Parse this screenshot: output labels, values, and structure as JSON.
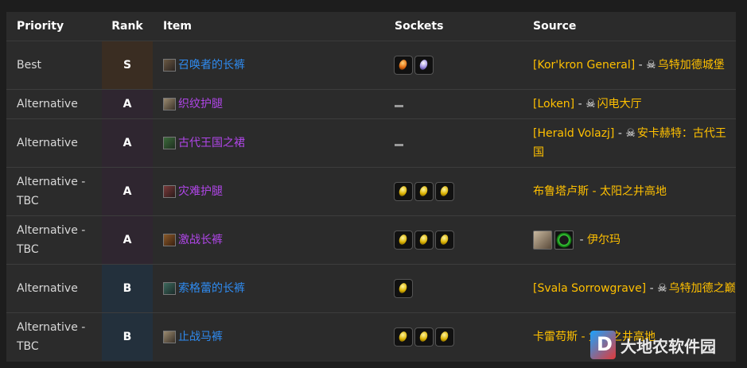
{
  "headers": [
    "Priority",
    "Rank",
    "Item",
    "Sockets",
    "Source"
  ],
  "rows": [
    {
      "priority": "Best",
      "rank": "S",
      "item": "召唤者的长裤",
      "source_boss": "[Kor'kron General]",
      "source_sep": " - ",
      "source_place": "乌特加德城堡"
    },
    {
      "priority": "Alternative",
      "rank": "A",
      "item": "织纹护腿",
      "source_boss": "[Loken]",
      "source_sep": " - ",
      "source_place": "闪电大厅"
    },
    {
      "priority": "Alternative",
      "rank": "A",
      "item": "古代王国之裙",
      "source_boss": "[Herald Volazj]",
      "source_sep": " - ",
      "source_place": "安卡赫特：古代王国"
    },
    {
      "priority": "Alternative - TBC",
      "rank": "A",
      "item": "灾难护腿",
      "source_text": "布鲁塔卢斯 - 太阳之井高地"
    },
    {
      "priority": "Alternative - TBC",
      "rank": "A",
      "item": "激战长裤",
      "source_sep": " - ",
      "source_place": "伊尔玛"
    },
    {
      "priority": "Alternative",
      "rank": "B",
      "item": "索格蕾的长裤",
      "source_boss": "[Svala Sorrowgrave]",
      "source_sep": " - ",
      "source_place": "乌特加德之巅"
    },
    {
      "priority": "Alternative - TBC",
      "rank": "B",
      "item": "止战马裤",
      "source_text": "卡雷苟斯 - 太阳之井高地"
    }
  ],
  "watermark": {
    "text": "大地农软件园",
    "logo_letter": "D"
  },
  "colors": {
    "rank_s": "#3a2d22",
    "rank_a": "#2f2630",
    "rank_b": "#23303c",
    "source": "#ffc000",
    "link_blue": "#2f8bf0",
    "link_purple": "#b046e8"
  },
  "icons": {
    "skull": "skull-icon",
    "sockets": "gem-socket-icon"
  }
}
